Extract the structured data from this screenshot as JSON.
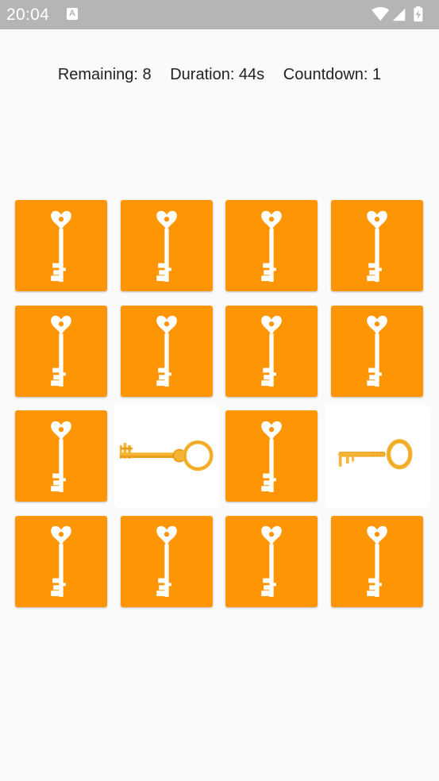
{
  "status_bar": {
    "time": "20:04",
    "notification_icon": "a-icon",
    "icons": [
      "wifi-icon",
      "signal-icon",
      "battery-charging-icon"
    ]
  },
  "stats": {
    "remaining": "Remaining: 8",
    "duration": "Duration: 44s",
    "countdown": "Countdown: 1"
  },
  "colors": {
    "card_back": "#fe9504",
    "card_face": "#ffffff",
    "key_gold": "#f5b432"
  },
  "board": {
    "columns": 4,
    "rows": 4,
    "cards": [
      {
        "state": "hidden",
        "icon": "white-key-icon"
      },
      {
        "state": "hidden",
        "icon": "white-key-icon"
      },
      {
        "state": "hidden",
        "icon": "white-key-icon"
      },
      {
        "state": "hidden",
        "icon": "white-key-icon"
      },
      {
        "state": "hidden",
        "icon": "white-key-icon"
      },
      {
        "state": "hidden",
        "icon": "white-key-icon"
      },
      {
        "state": "hidden",
        "icon": "white-key-icon"
      },
      {
        "state": "hidden",
        "icon": "white-key-icon"
      },
      {
        "state": "hidden",
        "icon": "white-key-icon"
      },
      {
        "state": "revealed",
        "icon": "gold-ornate-key-icon"
      },
      {
        "state": "hidden",
        "icon": "white-key-icon"
      },
      {
        "state": "revealed",
        "icon": "gold-simple-key-icon"
      },
      {
        "state": "hidden",
        "icon": "white-key-icon"
      },
      {
        "state": "hidden",
        "icon": "white-key-icon"
      },
      {
        "state": "hidden",
        "icon": "white-key-icon"
      },
      {
        "state": "hidden",
        "icon": "white-key-icon"
      }
    ]
  }
}
